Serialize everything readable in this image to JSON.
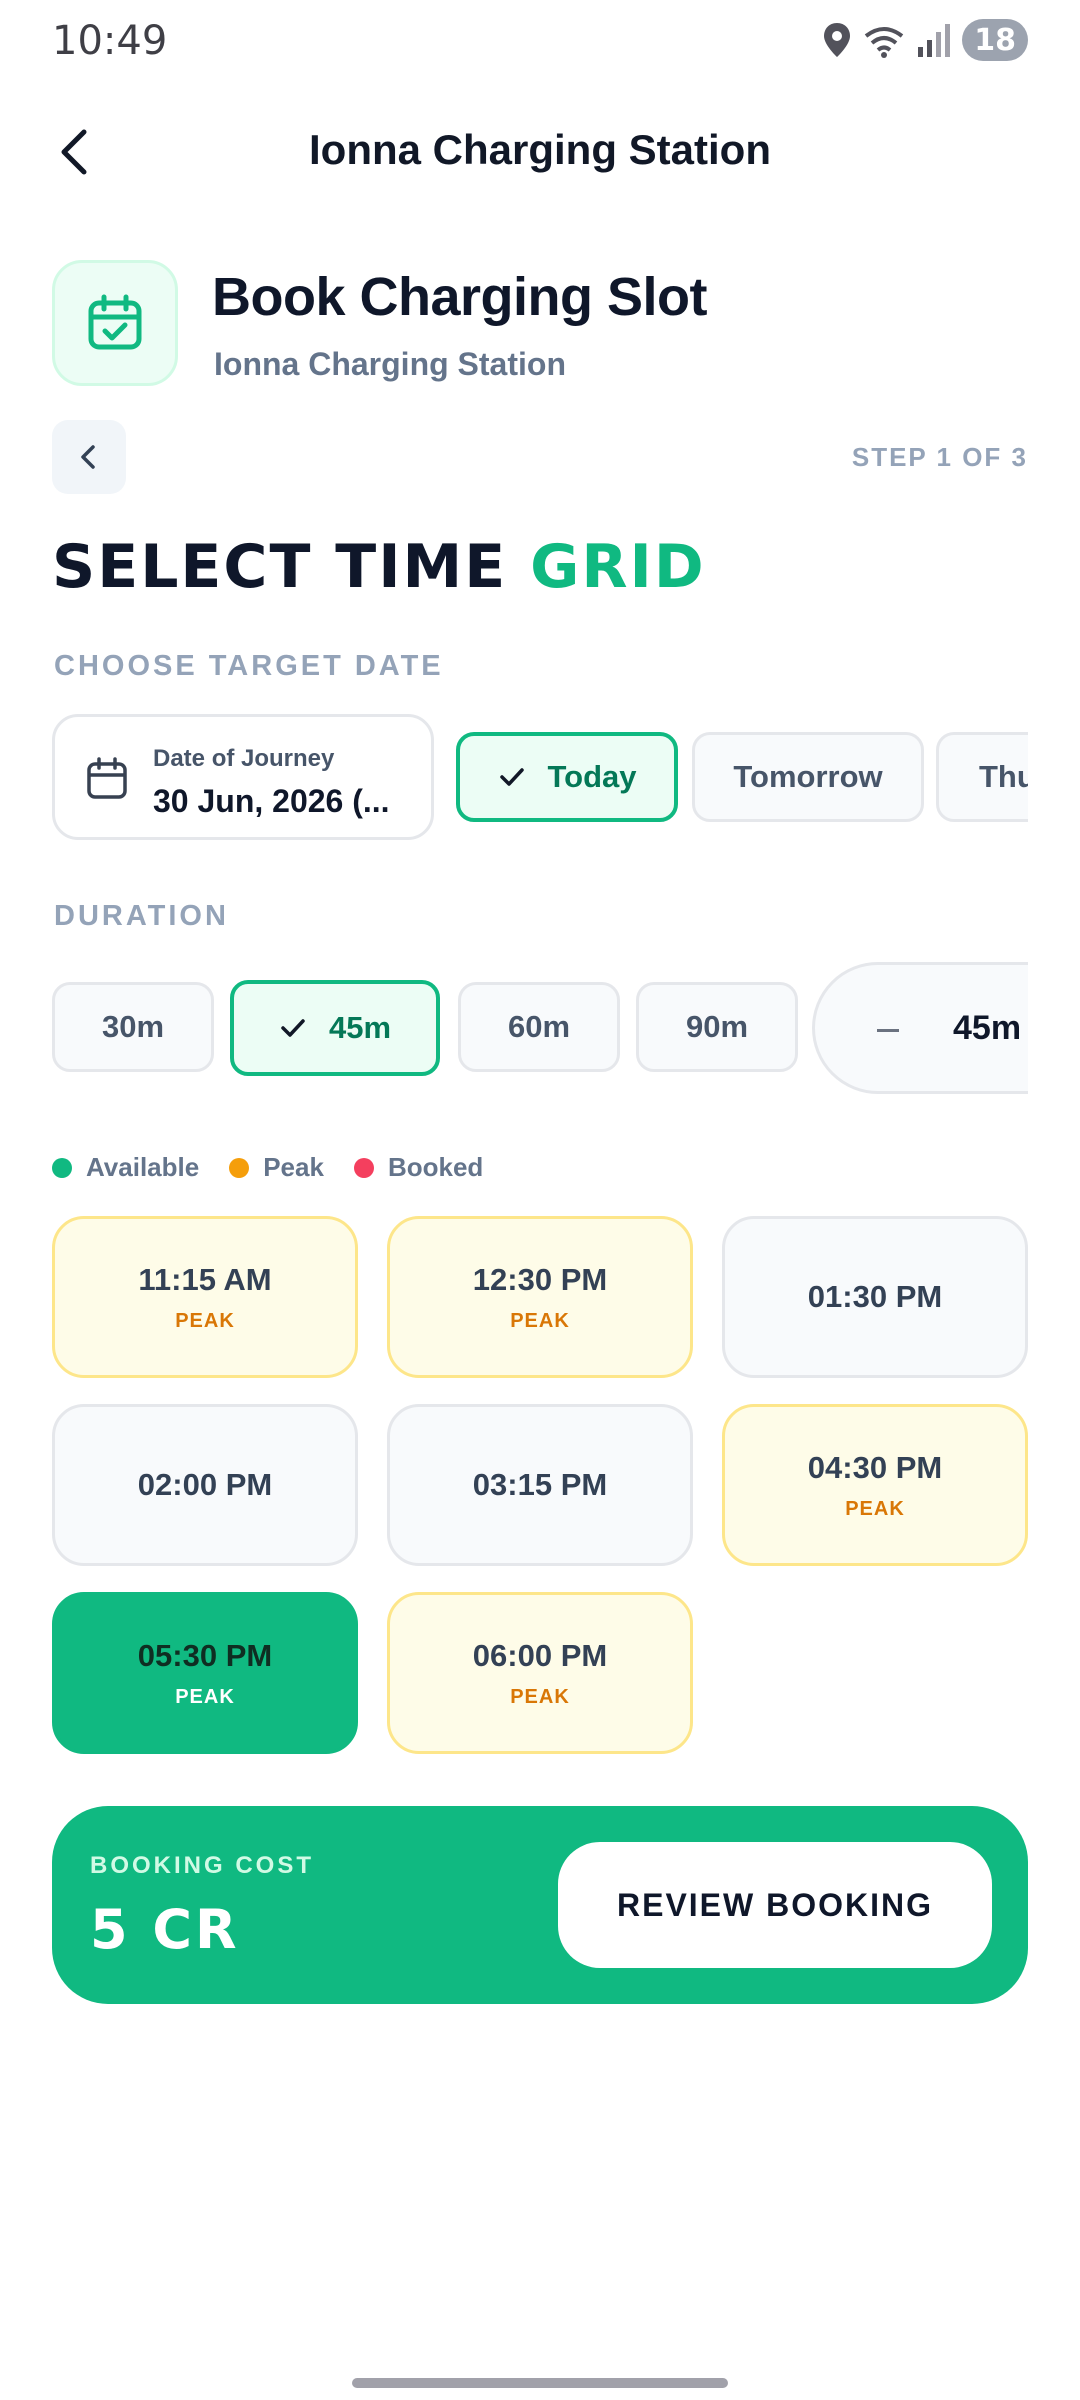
{
  "status_bar": {
    "time": "10:49",
    "battery": "18"
  },
  "header": {
    "title": "Ionna Charging Station"
  },
  "card": {
    "heading": "Book Charging Slot",
    "subtitle": "Ionna Charging Station"
  },
  "step": {
    "label": "STEP 1 OF 3"
  },
  "section": {
    "title_main": "SELECT TIME ",
    "title_accent": "GRID"
  },
  "date": {
    "section_label": "CHOOSE TARGET DATE",
    "picker_label": "Date of Journey",
    "picker_value": "30 Jun, 2026 (...",
    "chips": [
      "Today",
      "Tomorrow",
      "Thu"
    ],
    "selected": "Today"
  },
  "duration": {
    "section_label": "DURATION",
    "options": [
      "30m",
      "45m",
      "60m",
      "90m"
    ],
    "selected": "45m",
    "stepper_value": "45m"
  },
  "legend": [
    {
      "label": "Available",
      "color": "#10b981"
    },
    {
      "label": "Peak",
      "color": "#f59e0b"
    },
    {
      "label": "Booked",
      "color": "#f43f5e"
    }
  ],
  "slots": [
    {
      "time": "11:15 AM",
      "tag": "PEAK"
    },
    {
      "time": "12:30 PM",
      "tag": "PEAK"
    },
    {
      "time": "01:30 PM",
      "tag": ""
    },
    {
      "time": "02:00 PM",
      "tag": ""
    },
    {
      "time": "03:15 PM",
      "tag": ""
    },
    {
      "time": "04:30 PM",
      "tag": "PEAK"
    },
    {
      "time": "05:30 PM",
      "tag": "PEAK"
    },
    {
      "time": "06:00 PM",
      "tag": "PEAK"
    }
  ],
  "selected_slot": "05:30 PM",
  "cost": {
    "label": "BOOKING COST",
    "value": "5 CR",
    "button": "REVIEW BOOKING"
  },
  "colors": {
    "accent": "#10b981",
    "peak_bg": "#fefce8",
    "peak_text": "#d97706"
  }
}
